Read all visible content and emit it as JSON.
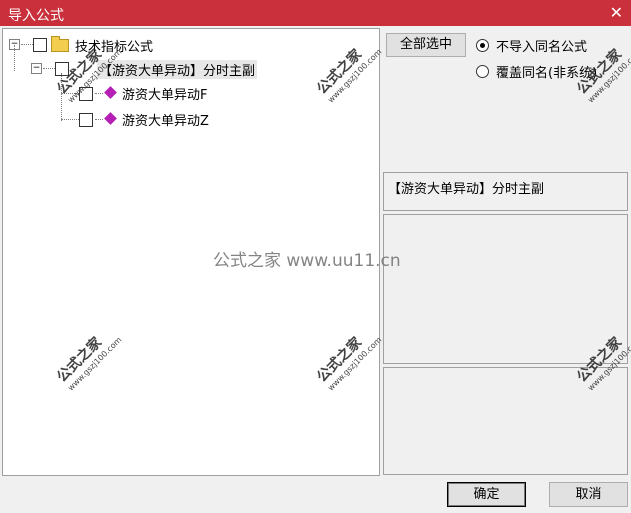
{
  "window": {
    "title": "导入公式",
    "close_glyph": "✕"
  },
  "tree": {
    "root_label": "技术指标公式",
    "toggle_collapsed": "⊟",
    "group_label": "【游资大单异动】分时主副",
    "items": [
      {
        "label": "游资大单异动F"
      },
      {
        "label": "游资大单异动Z"
      }
    ]
  },
  "options": {
    "select_all_label": "全部选中",
    "radio_no_import": "不导入同名公式",
    "radio_overwrite": "覆盖同名(非系统)"
  },
  "info": {
    "selected_name": "【游资大单异动】分时主副"
  },
  "footer": {
    "ok_label": "确定",
    "cancel_label": "取消"
  },
  "watermark": {
    "text": "公式之家",
    "url": "www.gszj100.com",
    "center": "公式之家 www.uu11.cn"
  },
  "colors": {
    "titlebar": "#c9303b",
    "folder": "#f3cd4e",
    "formula_icon": "#b51fb5"
  }
}
